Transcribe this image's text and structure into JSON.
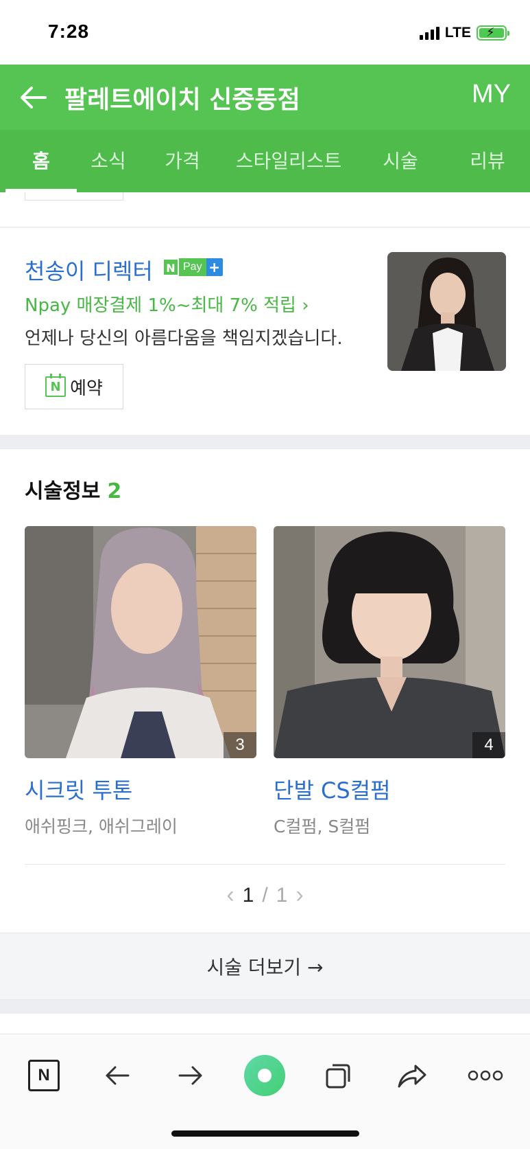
{
  "status_bar": {
    "time": "7:28",
    "network": "LTE",
    "battery_icon": "battery-charging-icon",
    "signal_icon": "signal-icon"
  },
  "header": {
    "back_icon": "back-arrow-icon",
    "title": "팔레트에이치 신중동점",
    "my_label": "MY"
  },
  "tabs": [
    {
      "label": "홈",
      "active": true
    },
    {
      "label": "소식",
      "active": false
    },
    {
      "label": "가격",
      "active": false
    },
    {
      "label": "스타일리스트",
      "active": false
    },
    {
      "label": "시술",
      "active": false
    },
    {
      "label": "리뷰",
      "active": false
    }
  ],
  "designer": {
    "name": "천송이 디렉터",
    "npay_badge": {
      "n": "N",
      "pay": "Pay",
      "plus": "+"
    },
    "npay_text": "Npay 매장결제 1%~최대 7% 적립 ›",
    "description": "언제나 당신의 아름다움을 책임지겠습니다.",
    "reserve_label": "예약",
    "reserve_icon_letter": "N"
  },
  "services": {
    "title": "시술정보",
    "count": "2",
    "items": [
      {
        "title": "시크릿 투톤",
        "tags": "애쉬핑크, 애쉬그레이",
        "photo_count": "3"
      },
      {
        "title": "단발 CS컬펌",
        "tags": "C컬펌, S컬펌",
        "photo_count": "4"
      }
    ],
    "pager": {
      "current": "1",
      "separator": "/",
      "total": "1",
      "prev_icon": "chevron-left-icon",
      "next_icon": "chevron-right-icon"
    },
    "more_label": "시술 더보기 →"
  },
  "toolbar": {
    "n_label": "N",
    "icons": [
      "naver-icon",
      "back-icon",
      "forward-icon",
      "green-dot-icon",
      "tabs-icon",
      "share-icon",
      "more-icon"
    ]
  },
  "colors": {
    "brand_green": "#56c452",
    "tab_green": "#4ebb4b",
    "link_blue": "#2a6fd0",
    "npay_green": "#46b843"
  }
}
